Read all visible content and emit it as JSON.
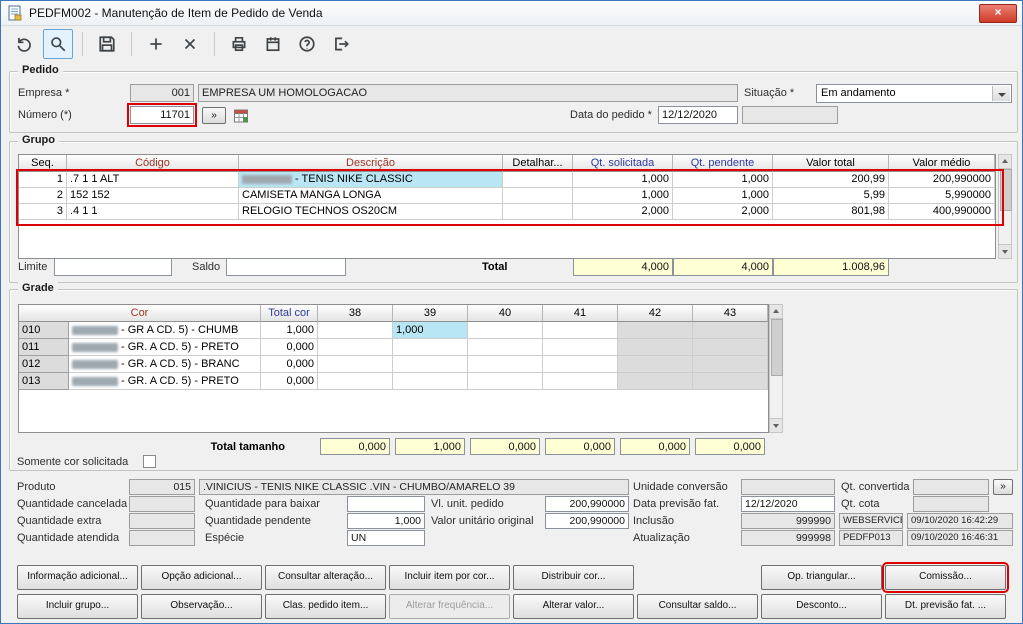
{
  "window": {
    "title": "PEDFM002 - Manutenção de Item de Pedido de Venda",
    "close_glyph": "×"
  },
  "toolbar": {
    "icons": [
      "undo-icon",
      "search-icon",
      "save-icon",
      "add-icon",
      "delete-icon",
      "print-icon",
      "schedule-icon",
      "help-icon",
      "exit-icon"
    ]
  },
  "colors": {
    "annotation_red": "#dd0000",
    "header_maroon": "#9a3324",
    "header_blue": "#2b3a9e",
    "selection_cyan": "#b9e6f5",
    "total_yellow": "#ffffd6"
  },
  "pedido": {
    "legend": "Pedido",
    "empresa_label": "Empresa *",
    "empresa_code": "001",
    "empresa_name": "EMPRESA UM HOMOLOGACAO",
    "situacao_label": "Situação *",
    "situacao_value": "Em andamento",
    "numero_label": "Número (*)",
    "numero_value": "11701",
    "expand_button": "»",
    "data_pedido_label": "Data do pedido *",
    "data_pedido_value": "12/12/2020"
  },
  "grupo": {
    "legend": "Grupo",
    "columns": [
      "Seq.",
      "Código",
      "Descrição",
      "Detalhar...",
      "Qt. solicitada",
      "Qt. pendente",
      "Valor total",
      "Valor médio"
    ],
    "rows": [
      {
        "seq": "1",
        "codigo": ".7 1 1 ALT",
        "descricao": "- TENIS NIKE CLASSIC",
        "descricao_censurada": true,
        "qt_solicitada": "1,000",
        "qt_pendente": "1,000",
        "valor_total": "200,99",
        "valor_medio": "200,990000"
      },
      {
        "seq": "2",
        "codigo": "152 152",
        "descricao": "CAMISETA MANGA LONGA",
        "qt_solicitada": "1,000",
        "qt_pendente": "1,000",
        "valor_total": "5,99",
        "valor_medio": "5,990000"
      },
      {
        "seq": "3",
        "codigo": ".4 1 1",
        "descricao": "RELOGIO TECHNOS OS20CM",
        "qt_solicitada": "2,000",
        "qt_pendente": "2,000",
        "valor_total": "801,98",
        "valor_medio": "400,990000"
      }
    ],
    "limite_label": "Limite",
    "saldo_label": "Saldo",
    "total_label": "Total",
    "total_qt_solicitada": "4,000",
    "total_qt_pendente": "4,000",
    "total_valor": "1.008,96"
  },
  "grade": {
    "legend": "Grade",
    "cor_header": "Cor",
    "total_cor_header": "Total cor",
    "size_headers": [
      "38",
      "39",
      "40",
      "41",
      "42",
      "43"
    ],
    "rows": [
      {
        "code": "010",
        "descricao": "- GR A CD. 5) - CHUMB",
        "total_cor": "1,000",
        "sizes": [
          "",
          "1,000",
          "",
          "",
          "",
          ""
        ]
      },
      {
        "code": "011",
        "descricao": "- GR. A CD. 5) - PRETO",
        "total_cor": "0,000",
        "sizes": [
          "",
          "",
          "",
          "",
          "",
          ""
        ]
      },
      {
        "code": "012",
        "descricao": "- GR. A CD. 5) - BRANC",
        "total_cor": "0,000",
        "sizes": [
          "",
          "",
          "",
          "",
          "",
          ""
        ]
      },
      {
        "code": "013",
        "descricao": "- GR. A CD. 5) - PRETO",
        "total_cor": "0,000",
        "sizes": [
          "",
          "",
          "",
          "",
          "",
          ""
        ]
      }
    ],
    "total_tamanho_label": "Total tamanho",
    "size_totals": [
      "0,000",
      "1,000",
      "0,000",
      "0,000",
      "0,000",
      "0,000"
    ],
    "somente_cor_label": "Somente cor solicitada"
  },
  "detalhe": {
    "produto_label": "Produto",
    "produto_code": "015",
    "produto_descricao": ".VINICIUS - TENIS NIKE CLASSIC .VIN - CHUMBO/AMARELO 39",
    "qtd_cancelada_label": "Quantidade cancelada",
    "qtd_extra_label": "Quantidade extra",
    "qtd_atendida_label": "Quantidade atendida",
    "qtd_baixar_label": "Quantidade para baixar",
    "qtd_pendente_label": "Quantidade pendente",
    "qtd_pendente_value": "1,000",
    "especie_label": "Espécie",
    "especie_value": "UN",
    "vl_unit_label": "Vl. unit. pedido",
    "vl_unit_value": "200,990000",
    "valor_unit_orig_label": "Valor unitário original",
    "valor_unit_orig_value": "200,990000",
    "unidade_conv_label": "Unidade conversão",
    "data_prev_label": "Data previsão fat.",
    "data_prev_value": "12/12/2020",
    "inclusao_label": "Inclusão",
    "inclusao_user": "999990",
    "inclusao_origem": "WEBSERVICE",
    "inclusao_data": "09/10/2020 16:42:29",
    "atualizacao_label": "Atualização",
    "atualizacao_user": "999998",
    "atualizacao_origem": "PEDFP013",
    "atualizacao_data": "09/10/2020 16:46:31",
    "qt_convertida_label": "Qt. convertida",
    "qt_cota_label": "Qt. cota",
    "expand_button": "»"
  },
  "buttons": {
    "row1": [
      "Informação adicional...",
      "Opção adicional...",
      "Consultar alteração...",
      "Incluir item por cor...",
      "Distribuir cor...",
      "Op. triangular...",
      "Comissão..."
    ],
    "row2": [
      "Incluir grupo...",
      "Observação...",
      "Clas. pedido item...",
      "Alterar frequência...",
      "Alterar valor...",
      "Consultar saldo...",
      "Desconto...",
      "Dt. previsão fat. ..."
    ]
  }
}
